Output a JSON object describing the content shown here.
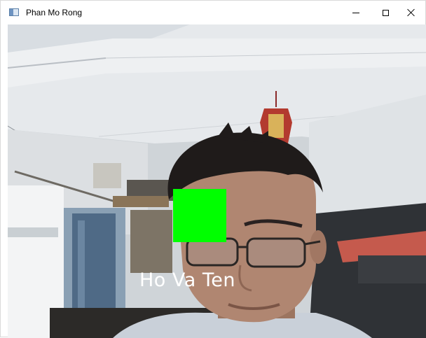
{
  "window": {
    "title": "Phan Mo Rong",
    "icon": "app-window-icon",
    "controls": {
      "minimize": "minimize-icon",
      "maximize": "maximize-icon",
      "close": "close-icon"
    }
  },
  "video": {
    "caption": "Ho Va Ten",
    "roi_color": "#00ff00",
    "caption_color": "#ffffff"
  }
}
